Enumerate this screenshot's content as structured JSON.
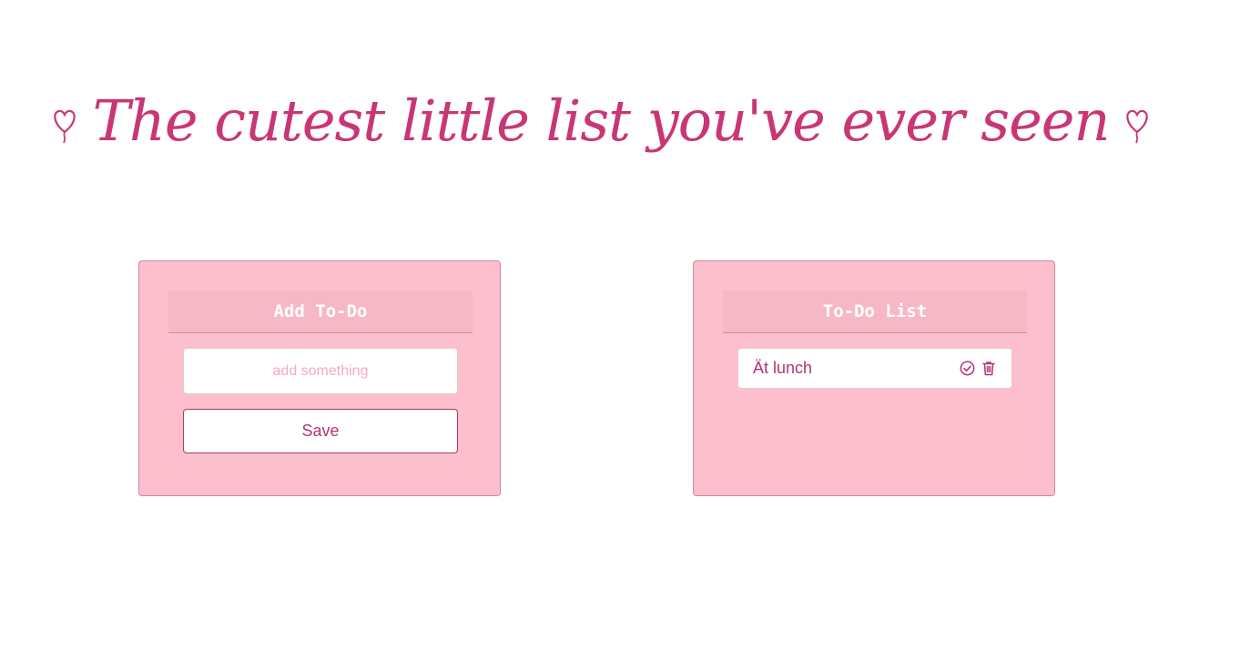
{
  "page": {
    "title": "The cutest little list you've ever seen"
  },
  "add_panel": {
    "header": "Add To-Do",
    "input_placeholder": "add something",
    "input_value": "",
    "save_label": "Save"
  },
  "list_panel": {
    "header": "To-Do List",
    "items": [
      {
        "text": "Ät lunch",
        "icons": [
          "check-circle-icon",
          "trash-icon"
        ]
      }
    ]
  },
  "colors": {
    "accent": "#c93676",
    "panel_bg": "#fdbfcd",
    "header_bg": "#f7b8c6",
    "text": "#b33572"
  },
  "icons": {
    "title_left": "heart-balloon-icon",
    "title_right": "heart-balloon-icon"
  }
}
